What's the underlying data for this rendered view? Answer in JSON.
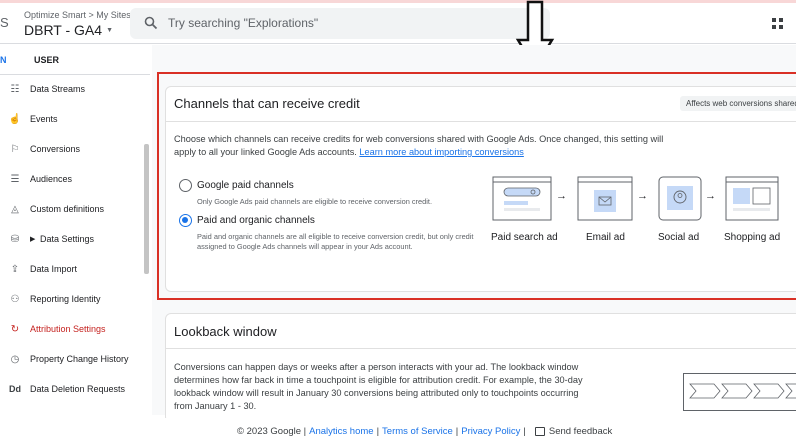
{
  "header": {
    "breadcrumb": "Optimize Smart > My Sites",
    "property_name": "DBRT - GA4",
    "search_placeholder": "Try searching \"Explorations\"",
    "edge_glyph": "S"
  },
  "nav_tabs": {
    "admin_fragment": "N",
    "user": "USER"
  },
  "sidebar": {
    "items": [
      {
        "label": "Data Streams",
        "icon": "data-streams-icon"
      },
      {
        "label": "Events",
        "icon": "events-icon"
      },
      {
        "label": "Conversions",
        "icon": "flag-icon"
      },
      {
        "label": "Audiences",
        "icon": "audiences-icon"
      },
      {
        "label": "Custom definitions",
        "icon": "custom-definitions-icon"
      },
      {
        "label": "Data Settings",
        "icon": "database-icon"
      },
      {
        "label": "Data Import",
        "icon": "upload-icon"
      },
      {
        "label": "Reporting Identity",
        "icon": "reporting-identity-icon"
      },
      {
        "label": "Attribution Settings",
        "icon": "attribution-icon",
        "active": true
      },
      {
        "label": "Property Change History",
        "icon": "history-icon"
      },
      {
        "label": "Data Deletion Requests",
        "icon": "dd-icon"
      }
    ],
    "dd_glyph": "Dd"
  },
  "channels_card": {
    "title": "Channels that can receive credit",
    "badge": "Affects web conversions shared",
    "description": "Choose which channels can receive credits for web conversions shared with Google Ads. Once changed, this setting will apply to all your linked Google Ads accounts.",
    "learn_more": "Learn more about importing conversions",
    "options": [
      {
        "label": "Google paid channels",
        "sub": "Only Google Ads paid channels are eligible to receive conversion credit.",
        "selected": false
      },
      {
        "label": "Paid and organic channels",
        "sub": "Paid and organic channels are all eligible to receive conversion credit, but only credit assigned to Google Ads channels will appear in your Ads account.",
        "selected": true
      }
    ],
    "ad_types": [
      "Paid search ad",
      "Email ad",
      "Social ad",
      "Shopping ad"
    ],
    "arrow_glyph": "→"
  },
  "lookback_card": {
    "title": "Lookback window",
    "description": "Conversions can happen days or weeks after a person interacts with your ad. The lookback window determines how far back in time a touchpoint is eligible for attribution credit. For example, the 30-day lookback window will result in January 30 conversions being attributed only to touchpoints occurring from January 1 - 30."
  },
  "footer": {
    "copyright": "© 2023 Google |",
    "links": [
      "Analytics home",
      "Terms of Service",
      "Privacy Policy"
    ],
    "separator": "|",
    "feedback": "Send feedback"
  },
  "colors": {
    "accent_blue": "#1a73e8",
    "annotation_red": "#d93025",
    "active_nav": "#c5221f",
    "illustration_blue": "#c5d9f7"
  }
}
